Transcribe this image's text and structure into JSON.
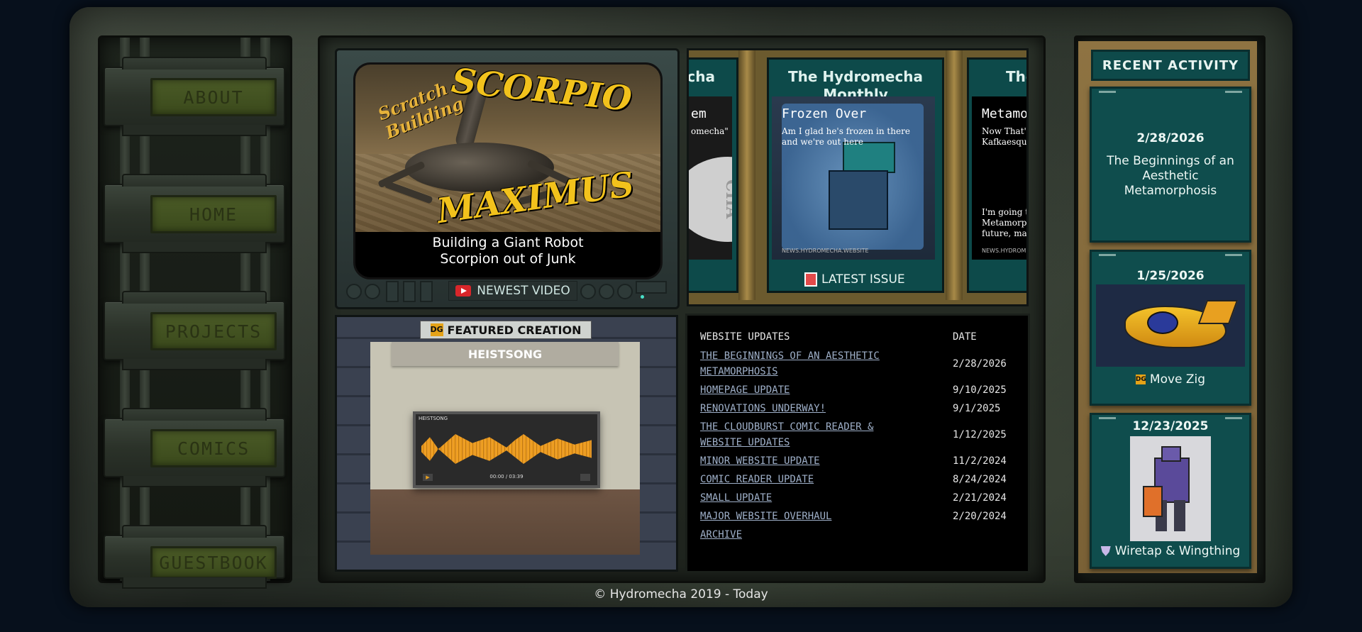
{
  "nav": {
    "items": [
      {
        "label": "ABOUT"
      },
      {
        "label": "HOME"
      },
      {
        "label": "PROJECTS"
      },
      {
        "label": "COMICS"
      },
      {
        "label": "GUESTBOOK"
      }
    ]
  },
  "video": {
    "thumb_text_1": "Scratch Building",
    "thumb_text_2": "SCORPIO",
    "thumb_text_3": "MAXIMUS",
    "title_line1": "Building a Giant Robot",
    "title_line2": "Scorpion out of Junk",
    "label": "NEWEST VIDEO"
  },
  "issues": {
    "left_partial_title": "echa",
    "left_partial_head": "em",
    "left_partial_sub": "omecha\"",
    "left_partial_stamp": "CHA",
    "center_title": "The Hydromecha Monthly",
    "center_head": "Frozen Over",
    "center_sub": "Am I glad he's frozen in there and we're out here",
    "center_foot": "NEWS.HYDROMECHA.WEBSITE",
    "right_partial_title": "The",
    "right_partial_head": "Metamo",
    "right_partial_sub": "Now That'\nKafkaesqu",
    "right_partial_body": "I'm going to\nMetamorphe\nfuture, mark",
    "right_partial_foot": "NEWS.HYDROM",
    "label": "LATEST ISSUE"
  },
  "featured": {
    "label": "FEATURED CREATION",
    "badge": "DG",
    "banner": "HEISTSONG",
    "player_title": "HEISTSONG",
    "player_time": "00:00 / 03:39"
  },
  "updates": {
    "col_title": "WEBSITE UPDATES",
    "col_date": "DATE",
    "rows": [
      {
        "title": "THE BEGINNINGS OF AN AESTHETIC METAMORPHOSIS",
        "date": "2/28/2026"
      },
      {
        "title": "HOMEPAGE UPDATE",
        "date": "9/10/2025"
      },
      {
        "title": "RENOVATIONS UNDERWAY!",
        "date": "9/1/2025"
      },
      {
        "title": "THE CLOUDBURST COMIC READER & WEBSITE UPDATES",
        "date": "1/12/2025"
      },
      {
        "title": "MINOR WEBSITE UPDATE",
        "date": "11/2/2024"
      },
      {
        "title": "COMIC READER UPDATE",
        "date": "8/24/2024"
      },
      {
        "title": "SMALL UPDATE",
        "date": "2/21/2024"
      },
      {
        "title": "MAJOR WEBSITE OVERHAUL",
        "date": "2/20/2024"
      },
      {
        "title": "ARCHIVE",
        "date": ""
      }
    ]
  },
  "activity": {
    "title": "RECENT ACTIVITY",
    "cards": [
      {
        "date": "2/28/2026",
        "text": "The Beginnings of an Aesthetic Metamorphosis"
      },
      {
        "date": "1/25/2026",
        "caption": "Move Zig",
        "badge": "DG"
      },
      {
        "date": "12/23/2025",
        "caption": "Wiretap & Wingthing"
      }
    ]
  },
  "footer": {
    "text": "© Hydromecha 2019 - Today"
  }
}
